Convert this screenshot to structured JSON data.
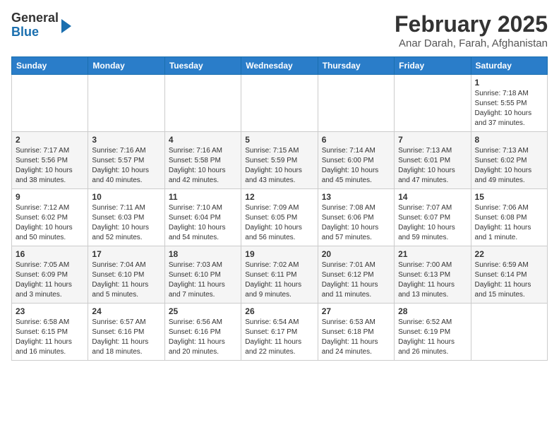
{
  "header": {
    "logo_general": "General",
    "logo_blue": "Blue",
    "month": "February 2025",
    "location": "Anar Darah, Farah, Afghanistan"
  },
  "weekdays": [
    "Sunday",
    "Monday",
    "Tuesday",
    "Wednesday",
    "Thursday",
    "Friday",
    "Saturday"
  ],
  "weeks": [
    [
      {
        "day": "",
        "info": ""
      },
      {
        "day": "",
        "info": ""
      },
      {
        "day": "",
        "info": ""
      },
      {
        "day": "",
        "info": ""
      },
      {
        "day": "",
        "info": ""
      },
      {
        "day": "",
        "info": ""
      },
      {
        "day": "1",
        "info": "Sunrise: 7:18 AM\nSunset: 5:55 PM\nDaylight: 10 hours and 37 minutes."
      }
    ],
    [
      {
        "day": "2",
        "info": "Sunrise: 7:17 AM\nSunset: 5:56 PM\nDaylight: 10 hours and 38 minutes."
      },
      {
        "day": "3",
        "info": "Sunrise: 7:16 AM\nSunset: 5:57 PM\nDaylight: 10 hours and 40 minutes."
      },
      {
        "day": "4",
        "info": "Sunrise: 7:16 AM\nSunset: 5:58 PM\nDaylight: 10 hours and 42 minutes."
      },
      {
        "day": "5",
        "info": "Sunrise: 7:15 AM\nSunset: 5:59 PM\nDaylight: 10 hours and 43 minutes."
      },
      {
        "day": "6",
        "info": "Sunrise: 7:14 AM\nSunset: 6:00 PM\nDaylight: 10 hours and 45 minutes."
      },
      {
        "day": "7",
        "info": "Sunrise: 7:13 AM\nSunset: 6:01 PM\nDaylight: 10 hours and 47 minutes."
      },
      {
        "day": "8",
        "info": "Sunrise: 7:13 AM\nSunset: 6:02 PM\nDaylight: 10 hours and 49 minutes."
      }
    ],
    [
      {
        "day": "9",
        "info": "Sunrise: 7:12 AM\nSunset: 6:02 PM\nDaylight: 10 hours and 50 minutes."
      },
      {
        "day": "10",
        "info": "Sunrise: 7:11 AM\nSunset: 6:03 PM\nDaylight: 10 hours and 52 minutes."
      },
      {
        "day": "11",
        "info": "Sunrise: 7:10 AM\nSunset: 6:04 PM\nDaylight: 10 hours and 54 minutes."
      },
      {
        "day": "12",
        "info": "Sunrise: 7:09 AM\nSunset: 6:05 PM\nDaylight: 10 hours and 56 minutes."
      },
      {
        "day": "13",
        "info": "Sunrise: 7:08 AM\nSunset: 6:06 PM\nDaylight: 10 hours and 57 minutes."
      },
      {
        "day": "14",
        "info": "Sunrise: 7:07 AM\nSunset: 6:07 PM\nDaylight: 10 hours and 59 minutes."
      },
      {
        "day": "15",
        "info": "Sunrise: 7:06 AM\nSunset: 6:08 PM\nDaylight: 11 hours and 1 minute."
      }
    ],
    [
      {
        "day": "16",
        "info": "Sunrise: 7:05 AM\nSunset: 6:09 PM\nDaylight: 11 hours and 3 minutes."
      },
      {
        "day": "17",
        "info": "Sunrise: 7:04 AM\nSunset: 6:10 PM\nDaylight: 11 hours and 5 minutes."
      },
      {
        "day": "18",
        "info": "Sunrise: 7:03 AM\nSunset: 6:10 PM\nDaylight: 11 hours and 7 minutes."
      },
      {
        "day": "19",
        "info": "Sunrise: 7:02 AM\nSunset: 6:11 PM\nDaylight: 11 hours and 9 minutes."
      },
      {
        "day": "20",
        "info": "Sunrise: 7:01 AM\nSunset: 6:12 PM\nDaylight: 11 hours and 11 minutes."
      },
      {
        "day": "21",
        "info": "Sunrise: 7:00 AM\nSunset: 6:13 PM\nDaylight: 11 hours and 13 minutes."
      },
      {
        "day": "22",
        "info": "Sunrise: 6:59 AM\nSunset: 6:14 PM\nDaylight: 11 hours and 15 minutes."
      }
    ],
    [
      {
        "day": "23",
        "info": "Sunrise: 6:58 AM\nSunset: 6:15 PM\nDaylight: 11 hours and 16 minutes."
      },
      {
        "day": "24",
        "info": "Sunrise: 6:57 AM\nSunset: 6:16 PM\nDaylight: 11 hours and 18 minutes."
      },
      {
        "day": "25",
        "info": "Sunrise: 6:56 AM\nSunset: 6:16 PM\nDaylight: 11 hours and 20 minutes."
      },
      {
        "day": "26",
        "info": "Sunrise: 6:54 AM\nSunset: 6:17 PM\nDaylight: 11 hours and 22 minutes."
      },
      {
        "day": "27",
        "info": "Sunrise: 6:53 AM\nSunset: 6:18 PM\nDaylight: 11 hours and 24 minutes."
      },
      {
        "day": "28",
        "info": "Sunrise: 6:52 AM\nSunset: 6:19 PM\nDaylight: 11 hours and 26 minutes."
      },
      {
        "day": "",
        "info": ""
      }
    ]
  ]
}
